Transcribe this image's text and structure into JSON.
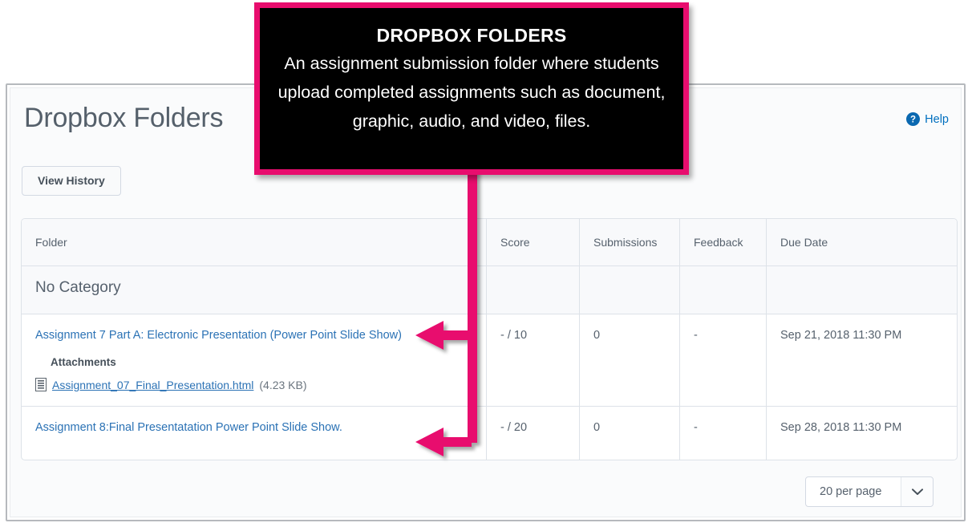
{
  "callout": {
    "title": "DROPBOX FOLDERS",
    "body": "An assignment submission folder where students upload completed assignments such as document, graphic, audio, and video, files.",
    "border_color": "#e80d6e",
    "background_color": "#000000",
    "text_color": "#ffffff"
  },
  "header": {
    "title": "Dropbox Folders",
    "help_label": "Help",
    "help_icon": "question-circle-icon",
    "view_history_label": "View History"
  },
  "table": {
    "columns": [
      "Folder",
      "Score",
      "Submissions",
      "Feedback",
      "Due Date"
    ],
    "category_label": "No Category",
    "rows": [
      {
        "folder": "Assignment 7 Part A: Electronic Presentation (Power Point Slide Show)",
        "score": "- / 10",
        "submissions": "0",
        "feedback": "-",
        "due_date": "Sep 21, 2018 11:30 PM",
        "attachments_label": "Attachments",
        "attachment_icon": "document-icon",
        "attachment_name": "Assignment_07_Final_Presentation.html",
        "attachment_size": "(4.23 KB)"
      },
      {
        "folder": "Assignment 8:Final Presentatation Power Point Slide Show.",
        "score": "- / 20",
        "submissions": "0",
        "feedback": "-",
        "due_date": "Sep 28, 2018 11:30 PM"
      }
    ]
  },
  "footer": {
    "per_page_label": "20 per page",
    "chevron_icon": "chevron-down-icon"
  },
  "colors": {
    "accent_pink": "#e80d6e",
    "link_blue": "#2b72b5",
    "help_blue": "#006fbf",
    "text_gray": "#56616d"
  }
}
